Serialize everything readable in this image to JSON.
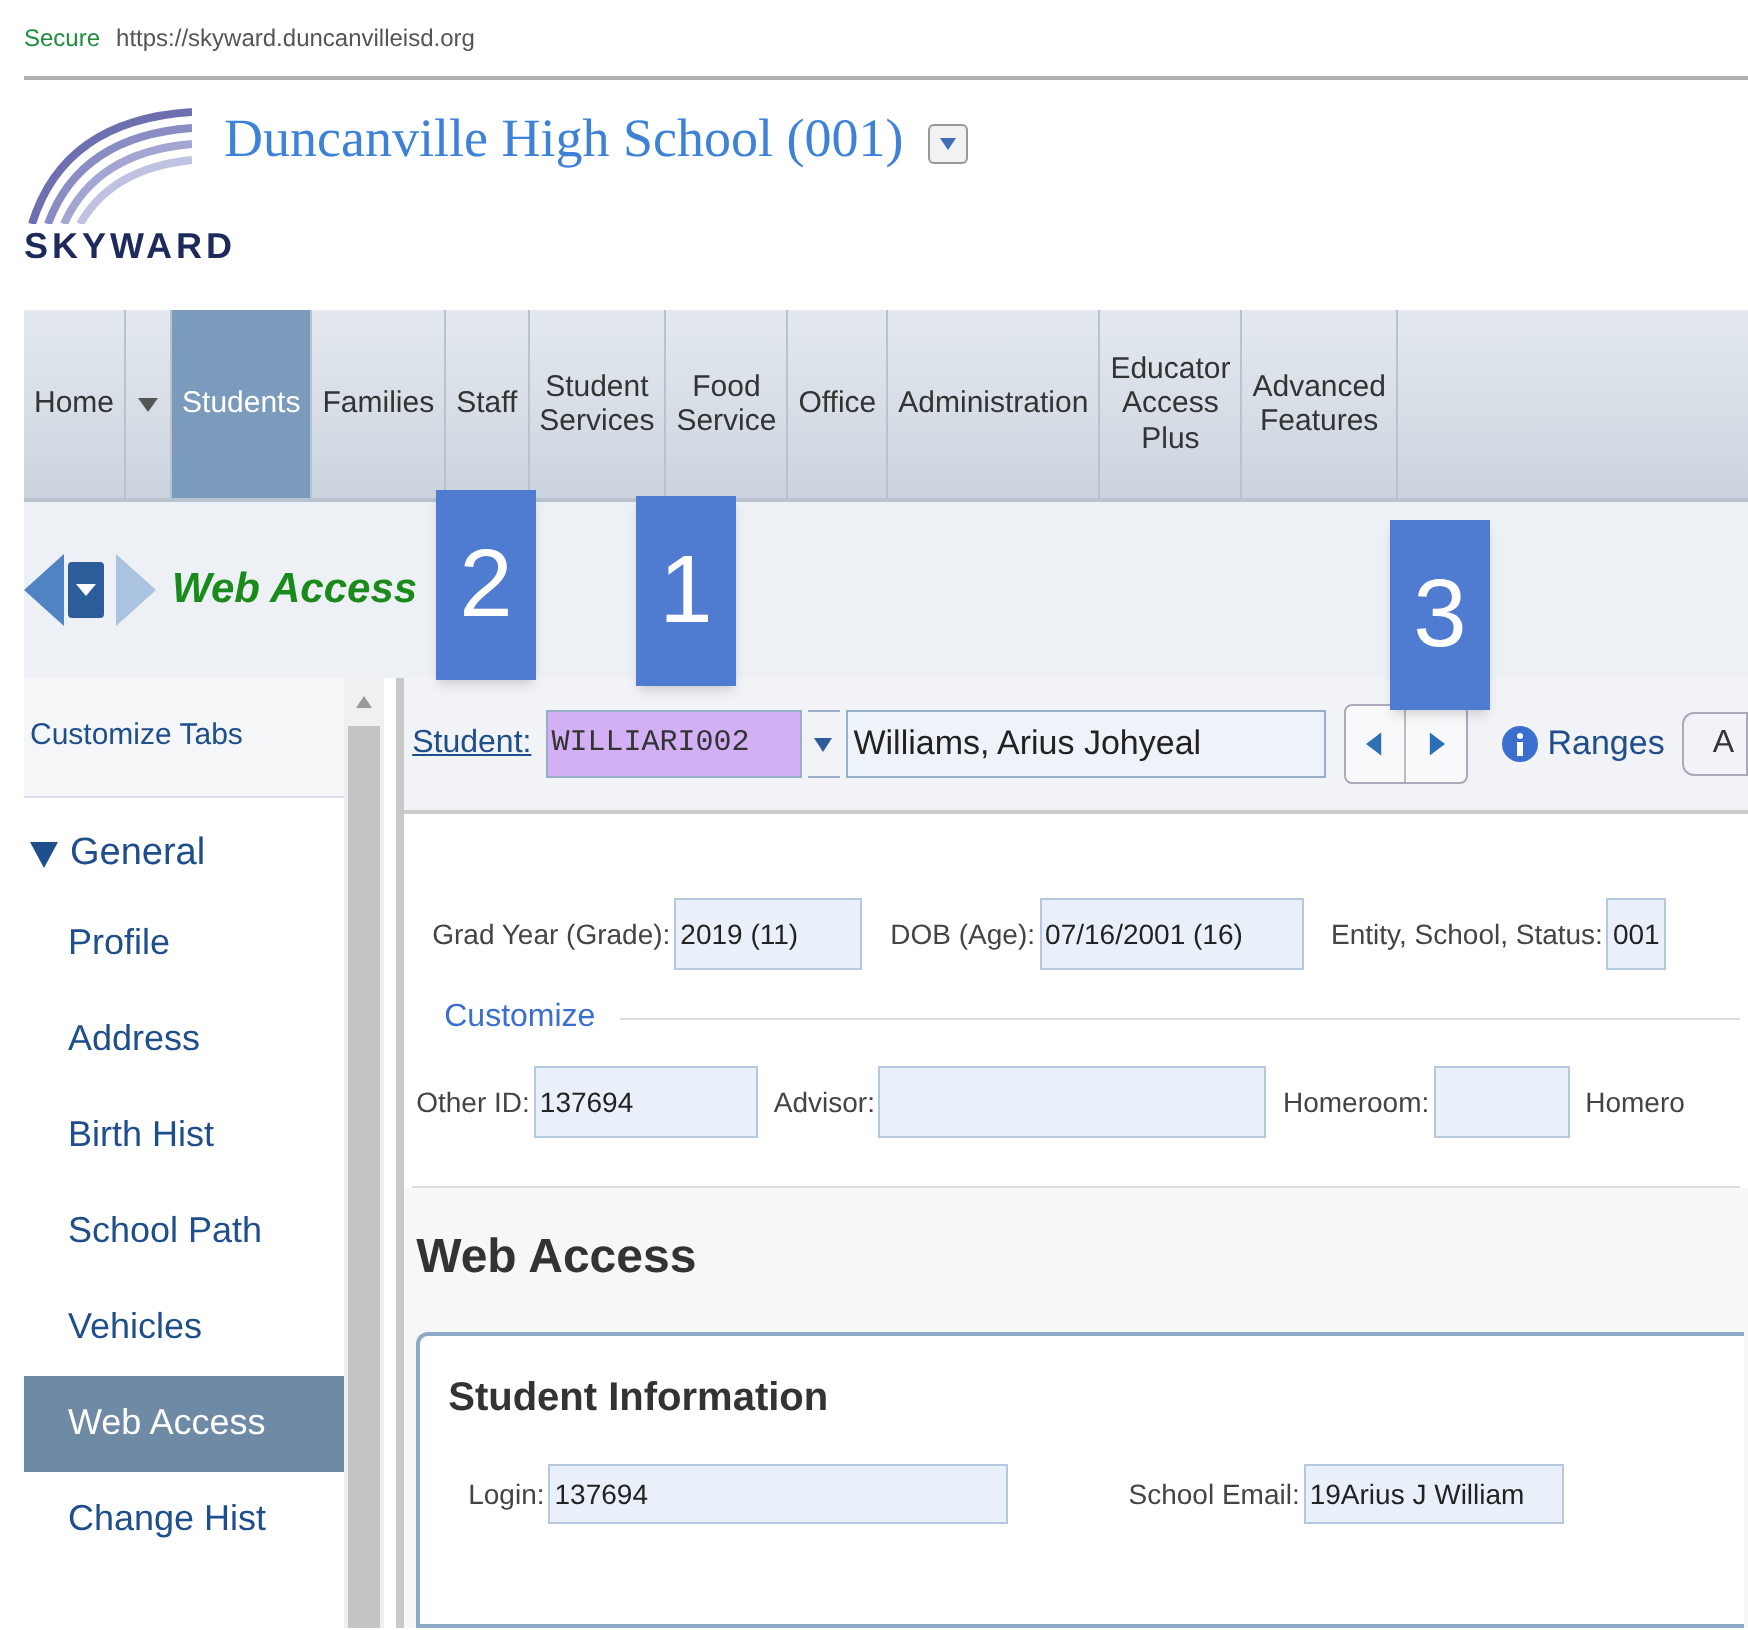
{
  "address_bar": {
    "secure_label": "Secure",
    "url": "https://skyward.duncanvilleisd.org"
  },
  "header": {
    "logo_text": "SKYWARD",
    "title": "Duncanville High School (001)"
  },
  "nav_tabs": [
    {
      "label": "Home",
      "selected": false,
      "has_menu": true
    },
    {
      "label": "Students",
      "selected": true,
      "has_menu": false
    },
    {
      "label": "Families",
      "selected": false,
      "has_menu": false
    },
    {
      "label": "Staff",
      "selected": false,
      "has_menu": false
    },
    {
      "label": "Student Services",
      "selected": false,
      "has_menu": false
    },
    {
      "label": "Food Service",
      "selected": false,
      "has_menu": false
    },
    {
      "label": "Office",
      "selected": false,
      "has_menu": false
    },
    {
      "label": "Administration",
      "selected": false,
      "has_menu": false
    },
    {
      "label": "Educator Access Plus",
      "selected": false,
      "has_menu": false
    },
    {
      "label": "Advanced Features",
      "selected": false,
      "has_menu": false
    }
  ],
  "page_title": "Web Access",
  "annotations": [
    {
      "label": "2"
    },
    {
      "label": "1"
    },
    {
      "label": "3"
    }
  ],
  "sidebar": {
    "header": "Customize Tabs",
    "group": {
      "label": "General",
      "expanded": true,
      "children": [
        {
          "label": "Profile",
          "selected": false
        },
        {
          "label": "Address",
          "selected": false
        },
        {
          "label": "Birth Hist",
          "selected": false
        },
        {
          "label": "School Path",
          "selected": false
        },
        {
          "label": "Vehicles",
          "selected": false
        },
        {
          "label": "Web Access",
          "selected": true
        },
        {
          "label": "Change Hist",
          "selected": false
        }
      ]
    }
  },
  "student_bar": {
    "link": "Student:",
    "id_value": "WILLIARI002",
    "name_value": "Williams, Arius Johyeal",
    "ranges": "Ranges",
    "cut_button": "A"
  },
  "summary_fields": [
    {
      "label": "Grad Year (Grade):",
      "value": "2019 (11)"
    },
    {
      "label": "DOB (Age):",
      "value": "07/16/2001 (16)"
    },
    {
      "label": "Entity, School, Status:",
      "value": "001"
    }
  ],
  "customize_link": "Customize",
  "detail_fields": [
    {
      "label": "Other ID:",
      "value": "137694"
    },
    {
      "label": "Advisor:"
    },
    {
      "label": "Homeroom:"
    },
    {
      "label": "Homero"
    }
  ],
  "section_title": "Web Access",
  "student_information": {
    "title": "Student Information",
    "fields": [
      {
        "label": "Login:",
        "value": "137694"
      },
      {
        "label": "School Email:",
        "value": "19Arius J William"
      }
    ]
  }
}
